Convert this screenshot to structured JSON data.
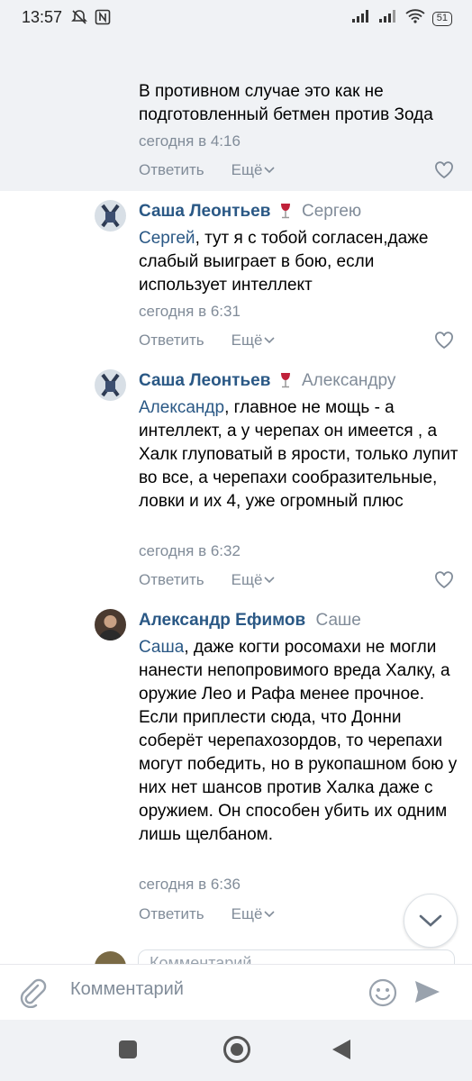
{
  "status_bar": {
    "time": "13:57",
    "left_icons": [
      "muted-bell-icon",
      "nfc-icon"
    ],
    "right_icons": [
      "signal-icon",
      "signal-icon",
      "wifi-icon",
      "battery-icon"
    ],
    "battery": "51"
  },
  "comments": [
    {
      "author": "",
      "reply_to": "",
      "mention": "",
      "text": "В противном случае это как не подготовленный бетмен против Зода",
      "time": "сегодня в 4:16",
      "reply_label": "Ответить",
      "more_label": "Ещё",
      "highlighted": true
    },
    {
      "author": "Саша Леонтьев",
      "reply_to": "Сергею",
      "mention": "Сергей",
      "text": ", тут я с тобой согласен,даже слабый выигрaет в бою, если использует интеллект",
      "time": "сегодня в 6:31",
      "reply_label": "Ответить",
      "more_label": "Ещё"
    },
    {
      "author": "Саша Леонтьев",
      "reply_to": "Александру",
      "mention": "Александр",
      "text": ", главное не мощь - а интеллект, а у черепах он имеется , а Халк глуповатый в ярости, только лупит во все, а черепахи сообразительные, ловки и их 4, уже огромный плюс",
      "time": "сегодня в 6:32",
      "reply_label": "Ответить",
      "more_label": "Ещё"
    },
    {
      "author": "Александр Ефимов",
      "reply_to": "Саше",
      "mention": "Саша",
      "text": ", даже когти росомахи не могли нанести непопровимого вреда Халку, а оружие Лео и Рафа менее прочное. Если приплести сюда, что Донни соберёт черепахозордов, то черепахи могут победить, но в рукопашном бою у них нет шансов против Халка даже с оружием. Он способен убить их одним лишь щелбаном.",
      "time": "сегодня в 6:36",
      "reply_label": "Ответить",
      "more_label": "Ещё"
    }
  ],
  "peek_input": {
    "placeholder": "Комментарий"
  },
  "composer": {
    "placeholder": "Комментарий",
    "icons": [
      "paperclip-icon",
      "smile-icon",
      "send-icon"
    ]
  },
  "colors": {
    "link": "#2a5885",
    "secondary": "#818c99",
    "highlight_bg": "#f0f2f5"
  }
}
